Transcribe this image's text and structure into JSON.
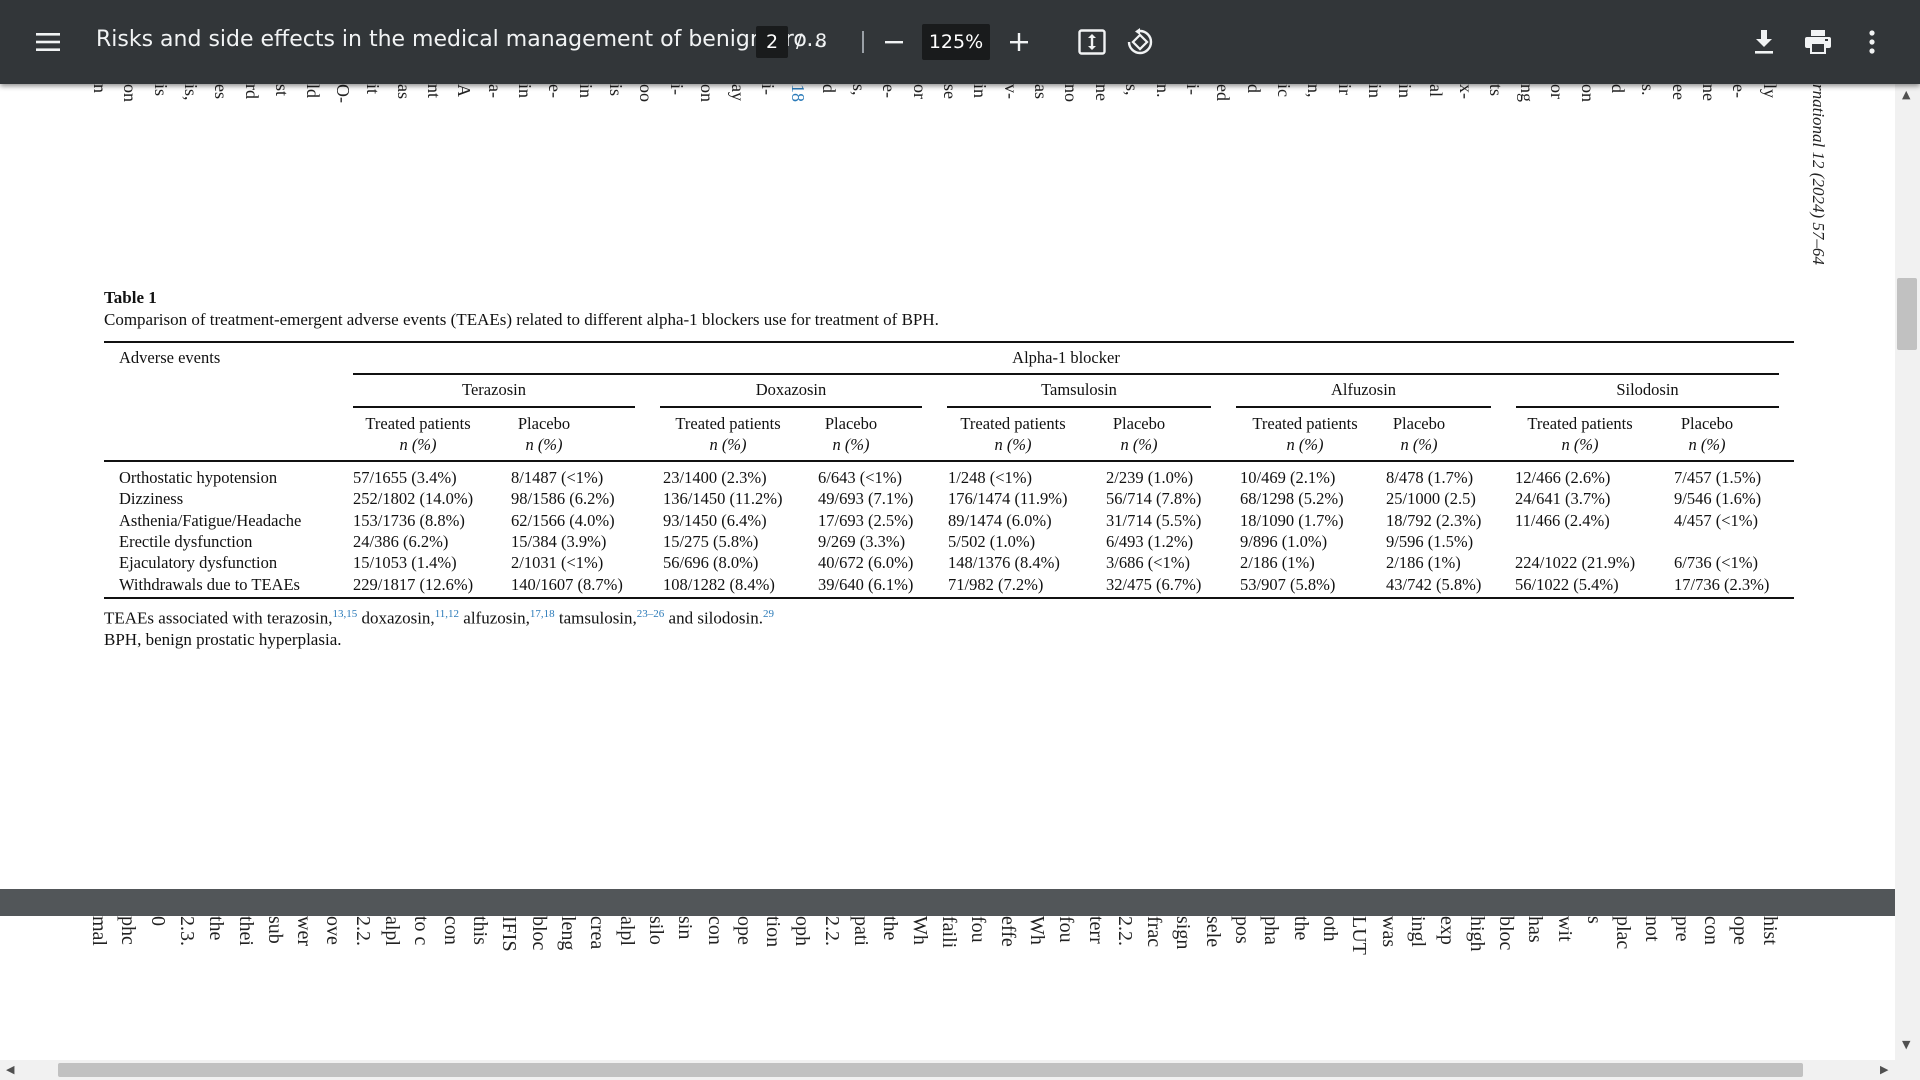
{
  "toolbar": {
    "menu_icon": "hamburger-menu-icon",
    "title": "Risks and side effects in the medical management of benign pro...",
    "current_page": "2",
    "page_separator": "/",
    "total_pages": "8",
    "zoom_out_icon": "minus-icon",
    "zoom_level": "125%",
    "zoom_in_icon": "plus-icon",
    "fit_icon": "fit-to-page-icon",
    "rotate_icon": "rotate-icon",
    "download_icon": "download-icon",
    "print_icon": "print-icon",
    "more_icon": "more-vert-icon"
  },
  "page_top": {
    "journal_ref": "rnational 12 (2024) 57–64",
    "fragments": [
      "n",
      "on",
      "is",
      "is,",
      "es",
      "rd",
      "st",
      "ld",
      "O-",
      "it",
      "as",
      "nt",
      "A",
      "a-",
      "in",
      "e-",
      "in",
      "is",
      "oo",
      "i-",
      "on",
      "ay",
      "i-",
      "18",
      "d",
      "s,",
      "e-",
      "or",
      "se",
      "in",
      "v-",
      "as",
      "no",
      "ne",
      "s,",
      "n.",
      "i-",
      "ed",
      "d",
      "ic",
      "n,",
      "ir",
      "in",
      "in",
      "al",
      "x-",
      "ts",
      "ng",
      "or",
      "on",
      "d",
      "s.",
      "ee",
      "ne",
      "e-",
      "ly"
    ]
  },
  "table": {
    "label": "Table 1",
    "caption": "Comparison of treatment-emergent adverse events (TEAEs) related to different alpha-1 blockers use for treatment of BPH.",
    "col0_header": "Adverse events",
    "group_header": "Alpha-1 blocker",
    "drugs": [
      "Terazosin",
      "Doxazosin",
      "Tamsulosin",
      "Alfuzosin",
      "Silodosin"
    ],
    "sub_headers": [
      "Treated patients",
      "Placebo"
    ],
    "unit": "n (%)",
    "rows": [
      {
        "label": "Orthostatic hypotension",
        "values": [
          "57/1655 (3.4%)",
          "8/1487 (<1%)",
          "23/1400 (2.3%)",
          "6/643 (<1%)",
          "1/248 (<1%)",
          "2/239 (1.0%)",
          "10/469 (2.1%)",
          "8/478 (1.7%)",
          "12/466 (2.6%)",
          "7/457 (1.5%)"
        ]
      },
      {
        "label": "Dizziness",
        "values": [
          "252/1802 (14.0%)",
          "98/1586 (6.2%)",
          "136/1450 (11.2%)",
          "49/693 (7.1%)",
          "176/1474 (11.9%)",
          "56/714 (7.8%)",
          "68/1298 (5.2%)",
          "25/1000 (2.5)",
          "24/641 (3.7%)",
          "9/546 (1.6%)"
        ]
      },
      {
        "label": "Asthenia/Fatigue/Headache",
        "values": [
          "153/1736 (8.8%)",
          "62/1566 (4.0%)",
          "93/1450 (6.4%)",
          "17/693 (2.5%)",
          "89/1474 (6.0%)",
          "31/714 (5.5%)",
          "18/1090 (1.7%)",
          "18/792 (2.3%)",
          "11/466 (2.4%)",
          "4/457 (<1%)"
        ]
      },
      {
        "label": "Erectile dysfunction",
        "values": [
          "24/386 (6.2%)",
          "15/384 (3.9%)",
          "15/275 (5.8%)",
          "9/269 (3.3%)",
          "5/502 (1.0%)",
          "6/493 (1.2%)",
          "9/896 (1.0%)",
          "9/596 (1.5%)",
          "",
          ""
        ]
      },
      {
        "label": "Ejaculatory dysfunction",
        "values": [
          "15/1053 (1.4%)",
          "2/1031 (<1%)",
          "56/696 (8.0%)",
          "40/672 (6.0%)",
          "148/1376 (8.4%)",
          "3/686 (<1%)",
          "2/186 (1%)",
          "2/186 (1%)",
          "224/1022 (21.9%)",
          "6/736 (<1%)"
        ]
      },
      {
        "label": "Withdrawals due to TEAEs",
        "values": [
          "229/1817 (12.6%)",
          "140/1607 (8.7%)",
          "108/1282 (8.4%)",
          "39/640 (6.1%)",
          "71/982 (7.2%)",
          "32/475 (6.7%)",
          "53/907 (5.8%)",
          "43/742 (5.8%)",
          "56/1022 (5.4%)",
          "17/736 (2.3%)"
        ]
      }
    ],
    "footnote_parts": [
      {
        "text": "TEAEs associated with terazosin,",
        "sup": "13,15"
      },
      {
        "text": " doxazosin,",
        "sup": "11,12"
      },
      {
        "text": " alfuzosin,",
        "sup": "17,18"
      },
      {
        "text": " tamsulosin,",
        "sup": "23–26"
      },
      {
        "text": " and silodosin.",
        "sup": "29"
      }
    ],
    "abbreviation": "BPH, benign prostatic hyperplasia."
  },
  "page_next": {
    "fragments": [
      "mal",
      "phc",
      "0",
      "2.3.",
      "the",
      "thei",
      "sub",
      "wer",
      "ove",
      "2.2.",
      "alpl",
      "to c",
      "con",
      "this",
      "IFIS",
      "bloc",
      "leng",
      "crea",
      "alpl",
      "silo",
      "sin",
      "con",
      "ope",
      "tion",
      "oph",
      "2.2.",
      "pati",
      "the",
      "Wh",
      "faili",
      "fou",
      "effe",
      "Wh",
      "fou",
      "terr",
      "2.2.",
      "frac",
      "sign",
      "sele",
      "pos",
      "pha",
      "the",
      "oth",
      "LUT",
      "was",
      "ingl",
      "exp",
      "high",
      "bloc",
      "has",
      "wit",
      "s",
      "plac",
      "not",
      "pre",
      "con",
      "ope",
      "hist"
    ]
  }
}
